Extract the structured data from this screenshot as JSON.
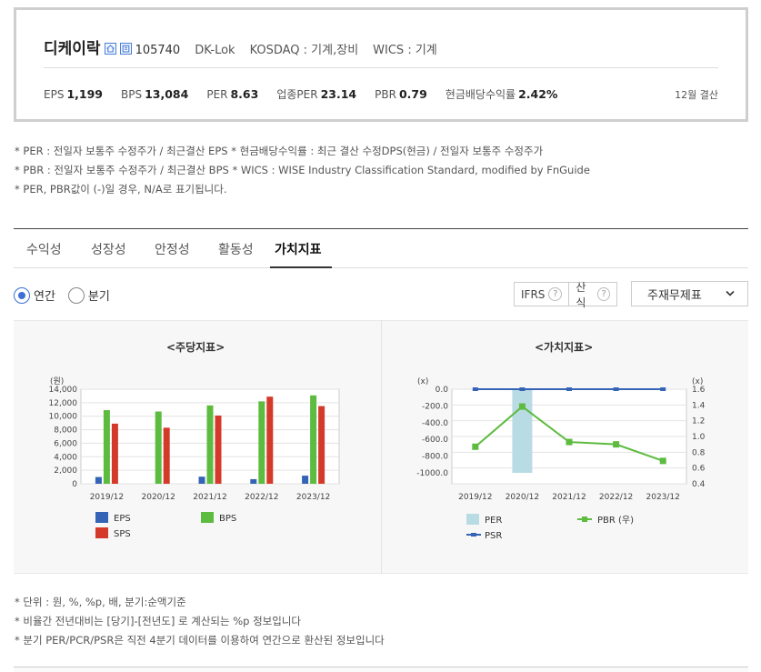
{
  "header": {
    "company": "디케이락",
    "code": "105740",
    "english_name": "DK-Lok",
    "market": "KOSDAQ : 기계,장비",
    "wics": "WICS : 기계",
    "settlement": "12월 결산",
    "metrics": [
      {
        "label": "EPS",
        "value": "1,199"
      },
      {
        "label": "BPS",
        "value": "13,084"
      },
      {
        "label": "PER",
        "value": "8.63"
      },
      {
        "label": "업종PER",
        "value": "23.14"
      },
      {
        "label": "PBR",
        "value": "0.79"
      },
      {
        "label": "현금배당수익률",
        "value": "2.42%"
      }
    ]
  },
  "notes": [
    "* PER : 전일자 보통주 수정주가 / 최근결산 EPS * 현금배당수익률 : 최근 결산 수정DPS(현금) / 전일자 보통주 수정주가",
    "* PBR : 전일자 보통주 수정주가 / 최근결산 BPS * WICS : WISE Industry Classification Standard, modified by FnGuide",
    "* PER, PBR값이 (-)일 경우, N/A로 표기됩니다."
  ],
  "tabs": [
    "수익성",
    "성장성",
    "안정성",
    "활동성",
    "가치지표"
  ],
  "active_tab": "가치지표",
  "period": {
    "annual": "연간",
    "quarter": "분기",
    "selected": "연간"
  },
  "controls": {
    "ifrs": "IFRS",
    "calc": "산식",
    "help": "?",
    "statement": "주재무제표"
  },
  "chart_data": [
    {
      "type": "bar",
      "title": "<주당지표>",
      "unit_label": "(원)",
      "categories": [
        "2019/12",
        "2020/12",
        "2021/12",
        "2022/12",
        "2023/12"
      ],
      "ylim": [
        0,
        14000
      ],
      "yticks": [
        "0",
        "2,000",
        "4,000",
        "6,000",
        "8,000",
        "10,000",
        "12,000",
        "14,000"
      ],
      "series": [
        {
          "name": "EPS",
          "color": "#3563b5",
          "values": [
            1000,
            0,
            1050,
            680,
            1199
          ]
        },
        {
          "name": "BPS",
          "color": "#5dbb3f",
          "values": [
            10900,
            10700,
            11600,
            12200,
            13084
          ]
        },
        {
          "name": "SPS",
          "color": "#d43a2a",
          "values": [
            8900,
            8300,
            10100,
            12900,
            11500
          ]
        }
      ]
    },
    {
      "type": "line",
      "title": "<가치지표>",
      "left_unit": "(x)",
      "right_unit": "(x)",
      "categories": [
        "2019/12",
        "2020/12",
        "2021/12",
        "2022/12",
        "2023/12"
      ],
      "left_ylim": [
        -1000,
        0
      ],
      "left_ticks": [
        "0.0",
        "-200.0",
        "-400.0",
        "-600.0",
        "-800.0",
        "-1000.0"
      ],
      "right_ylim": [
        0.4,
        1.6
      ],
      "right_ticks": [
        "1.6",
        "1.4",
        "1.2",
        "1.0",
        "0.8",
        "0.6",
        "0.4"
      ],
      "series": [
        {
          "name": "PER",
          "color": "#b9dbe4",
          "values": [
            null,
            -1000,
            null,
            null,
            null
          ]
        },
        {
          "name": "PBR (우)",
          "color": "#5dbb3f",
          "values": [
            0.87,
            1.38,
            0.93,
            0.9,
            0.69
          ]
        },
        {
          "name": "PSR",
          "color": "#3563b5",
          "values": [
            0,
            0,
            0,
            0,
            0
          ]
        }
      ]
    }
  ],
  "footer": [
    "* 단위 : 원, %, %p, 배, 분기:순액기준",
    "* 비율간 전년대비는 [당기]-[전년도] 로 계산되는 %p 정보입니다",
    "* 분기 PER/PCR/PSR은 직전 4분기 데이터를 이용하여 연간으로 환산된 정보입니다"
  ]
}
